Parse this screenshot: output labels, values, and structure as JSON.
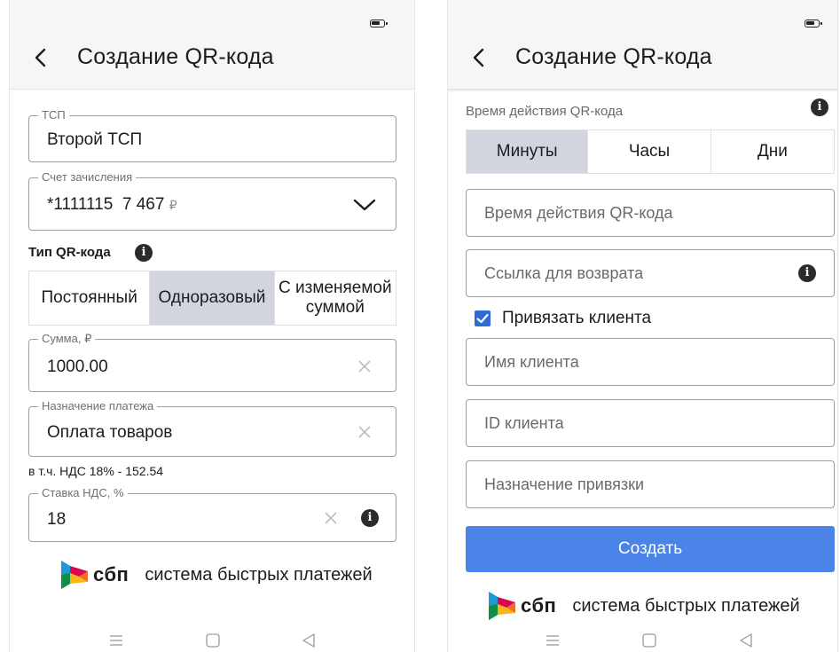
{
  "left": {
    "header": {
      "title": "Создание QR-кода"
    },
    "fields": {
      "tsp": {
        "label": "ТСП",
        "value": "Второй ТСП"
      },
      "account": {
        "label": "Счет зачисления",
        "value": "*1111115  7 467",
        "currency": "₽"
      },
      "amount": {
        "label": "Сумма, ₽",
        "value": "1000.00"
      },
      "purpose": {
        "label": "Назначение платежа",
        "value": "Оплата товаров"
      },
      "vat_rate": {
        "label": "Ставка НДС, %",
        "value": "18"
      }
    },
    "qr_type": {
      "label": "Тип QR-кода",
      "options": [
        "Постоянный",
        "Одноразовый",
        "С изменяемой суммой"
      ],
      "selected": "Одноразовый"
    },
    "vat_note": "в т.ч. НДС 18% - 152.54"
  },
  "right": {
    "header": {
      "title": "Создание QR-кода"
    },
    "validity": {
      "label": "Время действия QR-кода",
      "units": [
        "Минуты",
        "Часы",
        "Дни"
      ],
      "selected": "Минуты"
    },
    "inputs": {
      "validity_time": {
        "placeholder": "Время действия QR-кода"
      },
      "return_link": {
        "placeholder": "Ссылка для возврата"
      },
      "client_name": {
        "placeholder": "Имя клиента"
      },
      "client_id": {
        "placeholder": "ID клиента"
      },
      "binding_purpose": {
        "placeholder": "Назначение привязки"
      }
    },
    "bind_client": {
      "label": "Привязать клиента",
      "checked": true
    },
    "create_button": "Создать"
  },
  "brand": {
    "short": "сбп",
    "full": "система быстрых платежей"
  },
  "colors": {
    "accent": "#4a84e8",
    "checkbox": "#2e6bd6",
    "segment_selected": "#d2d5de"
  },
  "icons": [
    "back-icon",
    "info-icon",
    "chevron-down-icon",
    "clear-icon",
    "menu-icon",
    "home-icon",
    "back-triangle-icon",
    "sbp-logo-icon",
    "battery-icon",
    "check-icon"
  ]
}
